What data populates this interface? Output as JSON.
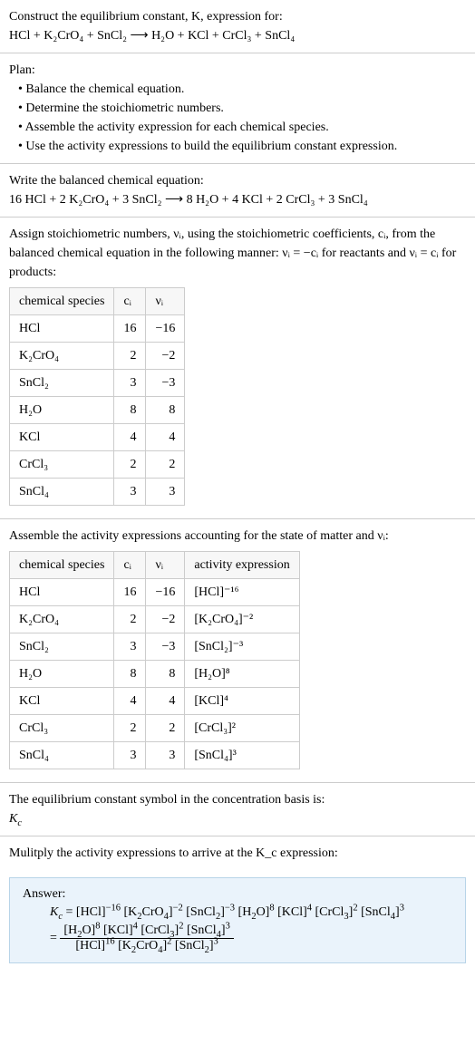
{
  "intro": {
    "line1": "Construct the equilibrium constant, K, expression for:",
    "line2": "HCl + K₂CrO₄ + SnCl₂ ⟶ H₂O + KCl + CrCl₃ + SnCl₄"
  },
  "plan": {
    "heading": "Plan:",
    "b1": "• Balance the chemical equation.",
    "b2": "• Determine the stoichiometric numbers.",
    "b3": "• Assemble the activity expression for each chemical species.",
    "b4": "• Use the activity expressions to build the equilibrium constant expression."
  },
  "balanced": {
    "heading": "Write the balanced chemical equation:",
    "eq": "16 HCl + 2 K₂CrO₄ + 3 SnCl₂ ⟶ 8 H₂O + 4 KCl + 2 CrCl₃ + 3 SnCl₄"
  },
  "stoich": {
    "text": "Assign stoichiometric numbers, νᵢ, using the stoichiometric coefficients, cᵢ, from the balanced chemical equation in the following manner: νᵢ = −cᵢ for reactants and νᵢ = cᵢ for products:",
    "h1": "chemical species",
    "h2": "cᵢ",
    "h3": "νᵢ",
    "rows": [
      {
        "sp": "HCl",
        "c": "16",
        "v": "−16"
      },
      {
        "sp": "K₂CrO₄",
        "c": "2",
        "v": "−2"
      },
      {
        "sp": "SnCl₂",
        "c": "3",
        "v": "−3"
      },
      {
        "sp": "H₂O",
        "c": "8",
        "v": "8"
      },
      {
        "sp": "KCl",
        "c": "4",
        "v": "4"
      },
      {
        "sp": "CrCl₃",
        "c": "2",
        "v": "2"
      },
      {
        "sp": "SnCl₄",
        "c": "3",
        "v": "3"
      }
    ]
  },
  "activity": {
    "text": "Assemble the activity expressions accounting for the state of matter and νᵢ:",
    "h1": "chemical species",
    "h2": "cᵢ",
    "h3": "νᵢ",
    "h4": "activity expression",
    "rows": [
      {
        "sp": "HCl",
        "c": "16",
        "v": "−16",
        "a": "[HCl]⁻¹⁶"
      },
      {
        "sp": "K₂CrO₄",
        "c": "2",
        "v": "−2",
        "a": "[K₂CrO₄]⁻²"
      },
      {
        "sp": "SnCl₂",
        "c": "3",
        "v": "−3",
        "a": "[SnCl₂]⁻³"
      },
      {
        "sp": "H₂O",
        "c": "8",
        "v": "8",
        "a": "[H₂O]⁸"
      },
      {
        "sp": "KCl",
        "c": "4",
        "v": "4",
        "a": "[KCl]⁴"
      },
      {
        "sp": "CrCl₃",
        "c": "2",
        "v": "2",
        "a": "[CrCl₃]²"
      },
      {
        "sp": "SnCl₄",
        "c": "3",
        "v": "3",
        "a": "[SnCl₄]³"
      }
    ]
  },
  "symbol": {
    "line1": "The equilibrium constant symbol in the concentration basis is:",
    "line2": "K_c"
  },
  "multiply": "Mulitply the activity expressions to arrive at the K_c expression:",
  "answer": {
    "label": "Answer:",
    "kc_line": "K_c = [HCl]⁻¹⁶ [K₂CrO₄]⁻² [SnCl₂]⁻³ [H₂O]⁸ [KCl]⁴ [CrCl₃]² [SnCl₄]³",
    "eq": "=",
    "frac_num": "[H₂O]⁸ [KCl]⁴ [CrCl₃]² [SnCl₄]³",
    "frac_den": "[HCl]¹⁶ [K₂CrO₄]² [SnCl₂]³"
  }
}
